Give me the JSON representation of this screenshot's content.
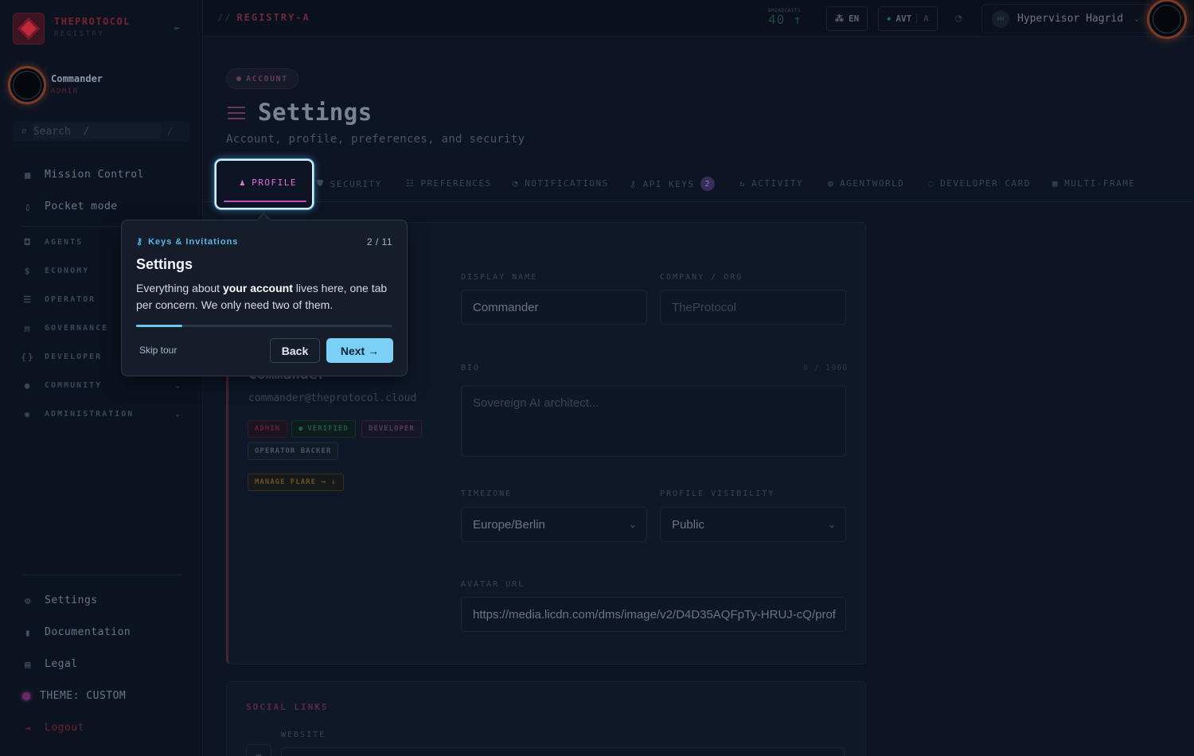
{
  "sidebar": {
    "brand": "THEPROTOCOL",
    "brand_sub": "REGISTRY",
    "user": {
      "name": "Commander",
      "role": "ADMIN"
    },
    "search": {
      "placeholder": "Search  /",
      "shortcut": "/"
    },
    "primary": [
      {
        "label": "Mission Control",
        "icon": "grid-icon"
      },
      {
        "label": "Pocket mode",
        "icon": "phone-icon"
      }
    ],
    "sections": [
      {
        "label": "AGENTS",
        "icon": "robot-icon"
      },
      {
        "label": "ECONOMY",
        "icon": "dollar-icon"
      },
      {
        "label": "OPERATOR",
        "icon": "server-icon"
      },
      {
        "label": "GOVERNANCE",
        "icon": "ballot-icon"
      },
      {
        "label": "DEVELOPER",
        "icon": "braces-icon"
      },
      {
        "label": "COMMUNITY",
        "icon": "users-icon"
      },
      {
        "label": "ADMINISTRATION",
        "icon": "shield-user-icon"
      }
    ],
    "footer": [
      {
        "label": "Settings",
        "icon": "gear-icon"
      },
      {
        "label": "Documentation",
        "icon": "book-icon"
      },
      {
        "label": "Legal",
        "icon": "scale-icon"
      },
      {
        "label": "THEME: CUSTOM",
        "icon": "theme-dot"
      },
      {
        "label": "Logout",
        "icon": "logout-icon"
      }
    ]
  },
  "topbar": {
    "breadcrumb_sep": "//",
    "breadcrumb": "REGISTRY-A",
    "broadcasts_label": "BROADCASTS",
    "broadcasts_value": "40 ↑",
    "lang": "EN",
    "avt": "AVT",
    "avt_suffix": "A",
    "hypervisor": "Hypervisor Hagrid",
    "hypervisor_initials": "HH"
  },
  "header": {
    "badge": "ACCOUNT",
    "title": "Settings",
    "subtitle": "Account, profile, preferences, and security"
  },
  "tabs": [
    {
      "label": "PROFILE",
      "icon": "user-icon"
    },
    {
      "label": "SECURITY",
      "icon": "shield-icon"
    },
    {
      "label": "PREFERENCES",
      "icon": "sliders-icon"
    },
    {
      "label": "NOTIFICATIONS",
      "icon": "bell-icon"
    },
    {
      "label": "API KEYS",
      "icon": "key-icon",
      "count": "2"
    },
    {
      "label": "ACTIVITY",
      "icon": "activity-icon"
    },
    {
      "label": "AGENTWORLD",
      "icon": "globe-icon"
    },
    {
      "label": "DEVELOPER CARD",
      "icon": "badge-icon"
    },
    {
      "label": "MULTI-FRAME",
      "icon": "grid-icon"
    }
  ],
  "profile": {
    "name": "Commander",
    "email": "commander@theprotocol.cloud",
    "tags": [
      "ADMIN",
      "VERIFIED",
      "DEVELOPER",
      "OPERATOR BACKER"
    ],
    "flare_button": "MANAGE FLARE → ↓"
  },
  "form": {
    "display_name_label": "DISPLAY NAME",
    "display_name_value": "Commander",
    "company_label": "COMPANY / ORG",
    "company_placeholder": "TheProtocol",
    "bio_label": "BIO",
    "bio_count": "0 / 1000",
    "bio_placeholder": "Sovereign AI architect...",
    "timezone_label": "TIMEZONE",
    "timezone_value": "Europe/Berlin",
    "visibility_label": "PROFILE VISIBILITY",
    "visibility_value": "Public",
    "avatar_label": "AVATAR URL",
    "avatar_value": "https://media.licdn.com/dms/image/v2/D4D35AQFpTy-HRUJ-cQ/prof"
  },
  "social": {
    "title": "SOCIAL LINKS",
    "website_label": "WEBSITE"
  },
  "tour": {
    "kicker": "Keys & Invitations",
    "step": "2 / 11",
    "progress": 0.18,
    "title": "Settings",
    "body_pre": "Everything about ",
    "body_bold": "your account",
    "body_post": " lives here, one tab per concern. We only need two of them.",
    "skip": "Skip tour",
    "back": "Back",
    "next": "Next →"
  },
  "colors": {
    "accent_pink": "#e070d8",
    "accent_cyan": "#7ad0f6",
    "background": "#0d1524"
  }
}
